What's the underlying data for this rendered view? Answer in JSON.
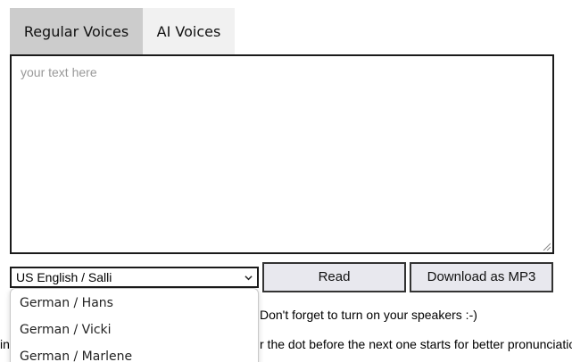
{
  "tabs": [
    {
      "label": "Regular Voices",
      "active": true
    },
    {
      "label": "AI Voices",
      "active": false
    }
  ],
  "textarea": {
    "placeholder": "your text here",
    "value": ""
  },
  "voice_select": {
    "selected": "US English / Salli",
    "visible_options": [
      "German / Hans",
      "German / Vicki",
      "German / Marlene"
    ]
  },
  "buttons": {
    "read": "Read",
    "download": "Download as MP3"
  },
  "hints": {
    "speakers": "Don't forget to turn on your speakers :-)",
    "pause_left": "in",
    "pause_right": "r the dot before the next one starts for better pronunciatio"
  },
  "colors": {
    "active_tab": "#cccccc",
    "inactive_tab": "#f1f1f1",
    "button_bg": "#e8e8ee",
    "border": "#1a1a1a"
  }
}
